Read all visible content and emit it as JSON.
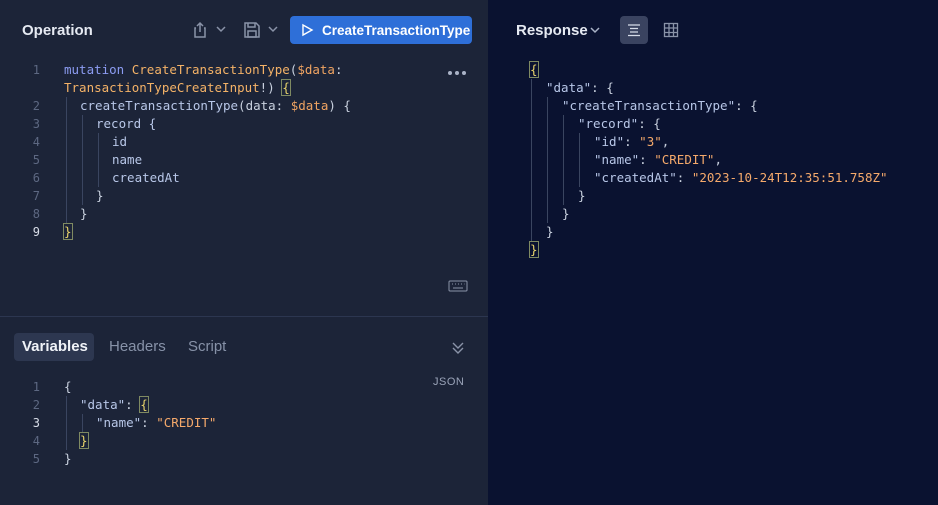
{
  "operation": {
    "title": "Operation",
    "run_label": "CreateTransactionType",
    "line_numbers": [
      "1",
      "2",
      "3",
      "4",
      "5",
      "6",
      "7",
      "8",
      "9"
    ],
    "code": {
      "l1_kw": "mutation",
      "l1_name": "CreateTransactionType",
      "l1_paren": "(",
      "l1_var": "$data",
      "l1_colon": ":",
      "l1b_type": "TransactionTypeCreateInput",
      "l1b_rest": "!)",
      "l1b_brace": "{",
      "l2_field": "createTransactionType",
      "l2_args_open": "(data: ",
      "l2_var": "$data",
      "l2_close": ") {",
      "l3": "record {",
      "l4": "id",
      "l5": "name",
      "l6": "createdAt",
      "l7": "}",
      "l8": "}",
      "l9": "}"
    }
  },
  "tabs": {
    "variables": "Variables",
    "headers": "Headers",
    "script": "Script"
  },
  "variables": {
    "mode": "JSON",
    "line_numbers": [
      "1",
      "2",
      "3",
      "4",
      "5"
    ],
    "l1": "{",
    "l2_key": "\"data\"",
    "l2_colon": ": ",
    "l2_brace": "{",
    "l3_key": "\"name\"",
    "l3_colon": ": ",
    "l3_val": "\"CREDIT\"",
    "l4": "}",
    "l5": "}"
  },
  "response": {
    "title": "Response",
    "l1": "{",
    "l2_key": "\"data\"",
    "l2_rest": ": {",
    "l3_key": "\"createTransactionType\"",
    "l3_rest": ": {",
    "l4_key": "\"record\"",
    "l4_rest": ": {",
    "l5_key": "\"id\"",
    "l5_sep": ": ",
    "l5_val": "\"3\"",
    "l5_comma": ",",
    "l6_key": "\"name\"",
    "l6_sep": ": ",
    "l6_val": "\"CREDIT\"",
    "l6_comma": ",",
    "l7_key": "\"createdAt\"",
    "l7_sep": ": ",
    "l7_val": "\"2023-10-24T12:35:51.758Z\"",
    "l8": "}",
    "l9": "}",
    "l10": "}",
    "l11": "}"
  }
}
